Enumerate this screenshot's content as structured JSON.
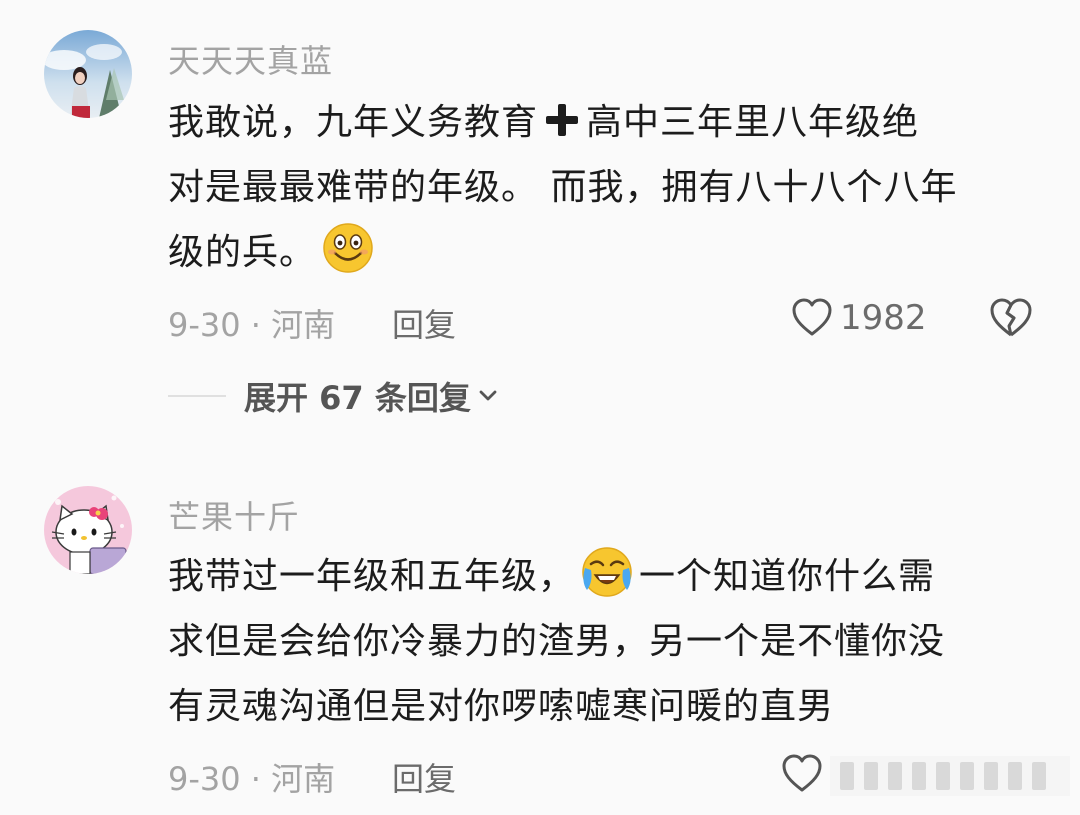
{
  "comments": [
    {
      "username": "天天天真蓝",
      "lines": [
        [
          "我敢说，九年义务教育",
          "plus",
          "高中三年里八年级绝"
        ],
        [
          "对是最最难带的年级。 而我，拥有八十八个八年"
        ],
        [
          "级的兵。",
          "emoji"
        ]
      ],
      "line1_a": "我敢说，九年义务教育",
      "line1_b": "高中三年里八年级绝",
      "line2": "对是最最难带的年级。 而我，拥有八十八个八年",
      "line3": "级的兵。",
      "meta": "9-30 · 河南",
      "reply_label": "回复",
      "like_count": "1982",
      "expand_label": "展开 67 条回复"
    },
    {
      "username": "芒果十斤",
      "line1_a": "我带过一年级和五年级，",
      "line1_b": "一个知道你什么需",
      "line2": "求但是会给你冷暴力的渣男，另一个是不懂你没",
      "line3": "有灵魂沟通但是对你啰嗦嘘寒问暖的直男",
      "meta": "9-30 · 河南",
      "reply_label": "回复"
    }
  ],
  "icons": {
    "like": "heart-outline-icon",
    "dislike": "broken-heart-icon",
    "expand": "chevron-down-icon",
    "emoji1": "smiling-emoji-icon",
    "emoji2": "crying-laughing-emoji-icon"
  },
  "colors": {
    "background": "#fafafa",
    "text": "#1c1c1c",
    "muted": "#a3a3a3",
    "secondary": "#6b6b6b",
    "emoji": "#f7c62f"
  }
}
